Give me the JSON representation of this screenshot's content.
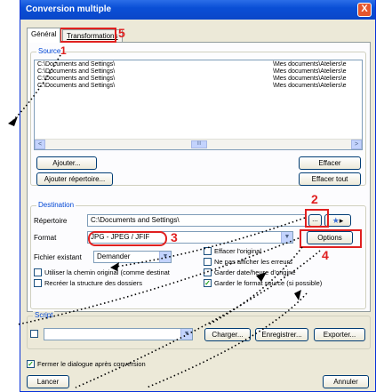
{
  "window": {
    "title": "Conversion multiple",
    "close_label": "X"
  },
  "tabs": [
    {
      "label": "Général"
    },
    {
      "label": "Transformations"
    }
  ],
  "source": {
    "label": "Source",
    "rows": [
      {
        "path": "C:\\Documents and Settings\\",
        "dest": "\\Mes documents\\Ateliers\\e"
      },
      {
        "path": "C:\\Documents and Settings\\",
        "dest": "\\Mes documents\\Ateliers\\e"
      },
      {
        "path": "C:\\Documents and Settings\\",
        "dest": "\\Mes documents\\Ateliers\\e"
      },
      {
        "path": "C:\\Documents and Settings\\",
        "dest": "\\Mes documents\\Ateliers\\e"
      }
    ],
    "add_button": "Ajouter...",
    "add_dir_button": "Ajouter répertoire...",
    "delete_button": "Effacer",
    "delete_all_button": "Effacer tout",
    "scroll_left": "<",
    "scroll_right": ">",
    "thumb_grip": "III"
  },
  "destination": {
    "label": "Destination",
    "dir_label": "Répertoire",
    "dir_value": "C:\\Documents and Settings\\",
    "browse_button": "...",
    "format_label": "Format",
    "format_value": "JPG - JPEG / JFIF",
    "options_button": "Options",
    "existing_label": "Fichier existant",
    "existing_value": "Demander",
    "chk_use_original": "Utiliser la chemin original (comme destinat",
    "chk_recreate": "Recréer la structure des dossiers",
    "chk_delete_original": "Effacer l'original",
    "chk_no_errors": "Ne pas afficher les erreurs",
    "chk_keep_date": "Garder date/heure d'origine",
    "chk_keep_format": "Garder le format source (si possible)"
  },
  "script": {
    "label": "Script",
    "load_button": "Charger...",
    "save_button": "Enregistrer...",
    "export_button": "Exporter..."
  },
  "footer": {
    "close_after": "Fermer le dialogue après conversion",
    "launch_button": "Lancer",
    "cancel_button": "Annuler"
  },
  "annotations": {
    "n1": "1",
    "n2": "2",
    "n3": "3",
    "n4": "4",
    "n5": "5"
  },
  "colors": {
    "titlebar": "#0a4fd6",
    "annotation": "#e02020",
    "group_label": "#0046d5"
  }
}
